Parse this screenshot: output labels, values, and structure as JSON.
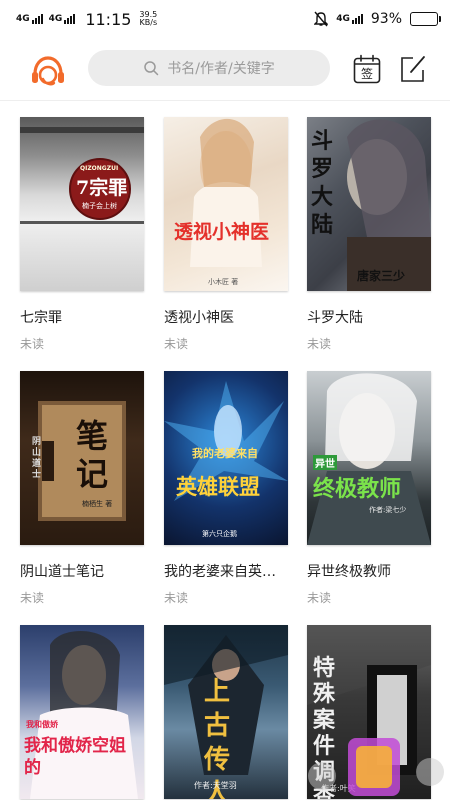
{
  "status_bar": {
    "sig1": "4G",
    "sig2": "4G",
    "time": "11:15",
    "speed_value": "39.5",
    "speed_unit": "KB/s",
    "sig3": "4G",
    "battery_pct": "93%",
    "battery_level": 0.93
  },
  "header": {
    "search_placeholder": "书名/作者/关键字",
    "checkin_label": "签"
  },
  "books": [
    {
      "title": "七宗罪",
      "status": "未读",
      "cover_text": "7宗罪",
      "cover_sub": "QIZONGZUI",
      "cover_author": "楠子会上树"
    },
    {
      "title": "透视小神医",
      "status": "未读",
      "cover_text": "透视小神医",
      "cover_author": "小木匠 著"
    },
    {
      "title": "斗罗大陆",
      "status": "未读",
      "cover_text": "斗罗大陆",
      "cover_author": "唐家三少"
    },
    {
      "title": "阴山道士笔记",
      "status": "未读",
      "cover_text": "笔记",
      "cover_sub": "阴山道士",
      "cover_author": "楠栖生 著"
    },
    {
      "title": "我的老婆来自英…",
      "status": "未读",
      "cover_text": "英雄联盟",
      "cover_sub": "我的老婆来自",
      "cover_author": "第六只企鹅"
    },
    {
      "title": "异世终极教师",
      "status": "未读",
      "cover_text": "终极教师",
      "cover_sub": "异世",
      "cover_author": "作者:梁七少"
    },
    {
      "title": "",
      "status": "",
      "cover_text": "我和傲娇空姐的",
      "cover_sub": "我和傲娇",
      "cover_author": ""
    },
    {
      "title": "",
      "status": "",
      "cover_text": "上古传人",
      "cover_author": "作者:天堂羽"
    },
    {
      "title": "",
      "status": "",
      "cover_text": "特殊案件调查",
      "cover_author": "作者:叶笑"
    }
  ],
  "icons": {
    "logo": "headphone-logo-icon",
    "search": "search-icon",
    "checkin": "calendar-checkin-icon",
    "edit": "edit-icon"
  },
  "colors": {
    "accent": "#f26b2b",
    "search_bg": "#ececec",
    "muted_text": "#999999"
  }
}
